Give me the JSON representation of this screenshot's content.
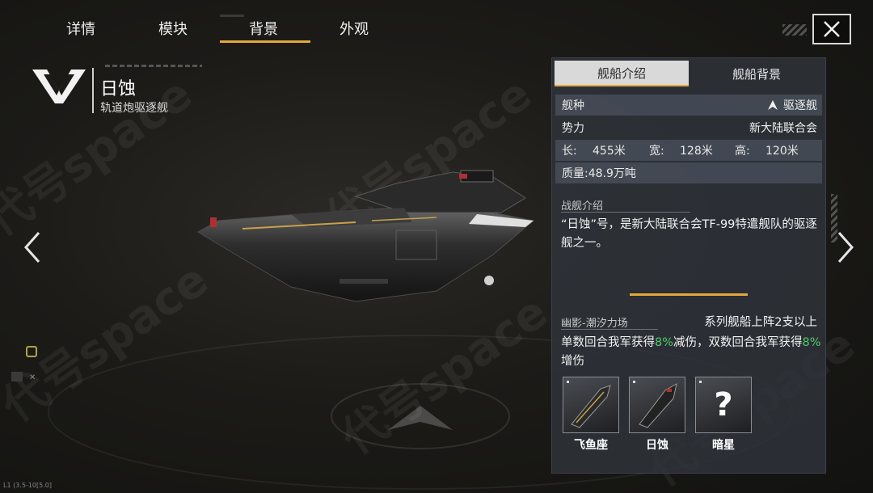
{
  "nav": {
    "tabs": [
      {
        "label": "详情"
      },
      {
        "label": "模块"
      },
      {
        "label": "背景"
      },
      {
        "label": "外观"
      }
    ],
    "active_tab": "背景"
  },
  "ship": {
    "name": "日蚀",
    "subtitle": "轨道炮驱逐舰"
  },
  "panel": {
    "tabs": {
      "intro": "舰船介绍",
      "background": "舰船背景"
    },
    "type_label": "舰种",
    "type_value": "驱逐舰",
    "faction_label": "势力",
    "faction_value": "新大陆联合会",
    "length_label": "长:",
    "length_value": "455米",
    "width_label": "宽:",
    "width_value": "128米",
    "height_label": "高:",
    "height_value": "120米",
    "mass": "质量:48.9万吨",
    "intro_title": "战舰介绍",
    "intro_text": "“日蚀”号，是新大陆联合会TF-99特遣舰队的驱逐舰之一。",
    "skill_title": "幽影-潮汐力场",
    "skill_cond": "系列舰船上阵2支以上",
    "skill_text_1": "单数回合我军获得",
    "skill_pct_1": "8%",
    "skill_text_2": "减伤，双数回合我军获得",
    "skill_pct_2": "8%",
    "skill_text_3": "增伤",
    "series": [
      {
        "label": "飞鱼座",
        "icon": "ship-thumb-icon"
      },
      {
        "label": "日蚀",
        "icon": "ship-thumb-icon"
      },
      {
        "label": "暗星",
        "icon": "unknown-question-icon",
        "glyph": "?"
      }
    ]
  },
  "footer": {
    "debug": "L1 (3.5-10[5.0]"
  },
  "watermark": "代号space",
  "colors": {
    "accent": "#e3a93a",
    "buff_green": "#4ecb6a"
  }
}
